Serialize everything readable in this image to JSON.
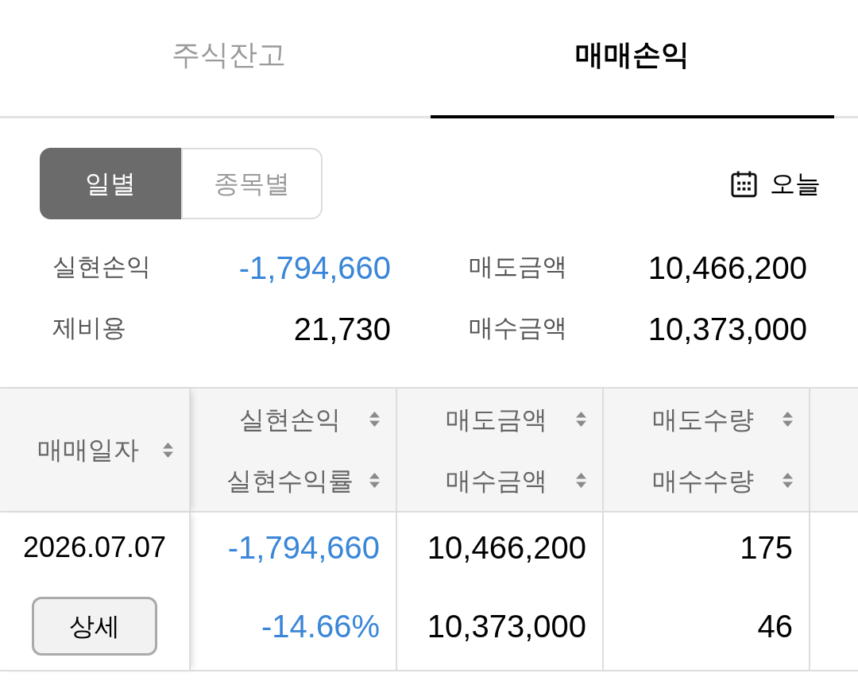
{
  "tabs": [
    {
      "label": "주식잔고",
      "selected": false
    },
    {
      "label": "매매손익",
      "selected": true
    }
  ],
  "view_toggle": [
    {
      "label": "일별",
      "selected": true
    },
    {
      "label": "종목별",
      "selected": false
    }
  ],
  "date_filter": {
    "label": "오늘"
  },
  "summary": [
    {
      "label": "실현손익",
      "value": "-1,794,660",
      "negative": true
    },
    {
      "label": "매도금액",
      "value": "10,466,200",
      "negative": false
    },
    {
      "label": "제비용",
      "value": "21,730",
      "negative": false
    },
    {
      "label": "매수금액",
      "value": "10,373,000",
      "negative": false
    }
  ],
  "table": {
    "columns": [
      {
        "labels": [
          "매매일자"
        ]
      },
      {
        "labels": [
          "실현손익",
          "실현수익률"
        ]
      },
      {
        "labels": [
          "매도금액",
          "매수금액"
        ]
      },
      {
        "labels": [
          "매도수량",
          "매수수량"
        ]
      }
    ],
    "rows": [
      {
        "cells": [
          [
            {
              "kind": "date",
              "text": "2026.07.07"
            },
            {
              "kind": "button",
              "text": "상세"
            }
          ],
          [
            {
              "kind": "number",
              "text": "-1,794,660",
              "negative": true
            },
            {
              "kind": "number",
              "text": "-14.66%",
              "negative": true
            }
          ],
          [
            {
              "kind": "number",
              "text": "10,466,200",
              "negative": false
            },
            {
              "kind": "number",
              "text": "10,373,000",
              "negative": false
            }
          ],
          [
            {
              "kind": "number",
              "text": "175",
              "negative": false
            },
            {
              "kind": "number",
              "text": "46",
              "negative": false
            }
          ]
        ]
      }
    ]
  }
}
